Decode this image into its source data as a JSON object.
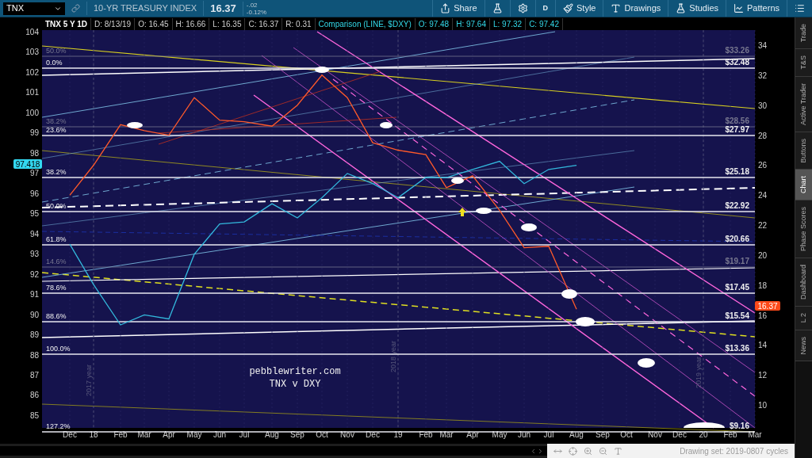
{
  "toolbar": {
    "symbol": "TNX",
    "description": "10-YR TREASURY INDEX",
    "last": "16.37",
    "change": "-.02",
    "change_pct": "-0.12%",
    "buttons": [
      {
        "kind": "share",
        "label": "Share"
      },
      {
        "kind": "flask"
      },
      {
        "kind": "gear"
      },
      {
        "kind": "text",
        "label": "D"
      },
      {
        "kind": "style",
        "label": "Style"
      },
      {
        "kind": "drawings",
        "label": "Drawings"
      },
      {
        "kind": "studies",
        "label": "Studies"
      },
      {
        "kind": "patterns",
        "label": "Patterns"
      },
      {
        "kind": "list"
      }
    ]
  },
  "info_bar": {
    "main": [
      "TNX 5 Y 1D",
      "D: 8/13/19",
      "O: 16.45",
      "H: 16.66",
      "L: 16.35",
      "C: 16.37",
      "R: 0.31"
    ],
    "comparison": "Comparison (LINE, $DXY)",
    "comparison_values": [
      "O: 97.48",
      "H: 97.64",
      "L: 97.32",
      "C: 97.42"
    ]
  },
  "chart": {
    "chart_data": {
      "type": "line",
      "categories": [
        "Dec",
        "18",
        "Feb",
        "Mar",
        "Apr",
        "May",
        "Jun",
        "Jul",
        "Aug",
        "Sep",
        "Oct",
        "Nov",
        "Dec",
        "19",
        "Feb",
        "Mar",
        "Apr",
        "May",
        "Jun",
        "Jul",
        "Aug",
        "Sep",
        "Oct",
        "Nov",
        "Dec",
        "20",
        "Feb",
        "Mar"
      ],
      "grid": true,
      "ylim": [
        84.4,
        104.1
      ],
      "y2lim": [
        8.5,
        35
      ],
      "yticks": [
        104,
        103,
        102,
        101,
        100,
        99,
        98,
        97,
        96,
        95,
        94,
        93,
        92,
        91,
        90,
        89,
        88,
        87,
        86,
        85
      ],
      "y2ticks": [
        34,
        32,
        30,
        28,
        26,
        24,
        22,
        20,
        18,
        16,
        14,
        12,
        10
      ],
      "series": [
        {
          "axis": "y2",
          "color": "#ff5a2a",
          "values": [
            24.0,
            26.0,
            28.7,
            28.3,
            28.0,
            30.5,
            29.0,
            28.9,
            28.6,
            30.0,
            32.0,
            30.5,
            27.5,
            27.0,
            26.7,
            24.5,
            25.3,
            23.0,
            20.5,
            20.6,
            16.4,
            null,
            null,
            null,
            null,
            null,
            null,
            null
          ]
        },
        {
          "color": "#33b8dc",
          "values": [
            93.5,
            91.5,
            89.5,
            90.0,
            89.8,
            93.0,
            94.5,
            94.6,
            95.5,
            94.8,
            95.8,
            97.0,
            96.5,
            95.8,
            96.8,
            96.8,
            97.2,
            97.6,
            96.5,
            97.2,
            97.4,
            null,
            null,
            null,
            null,
            null,
            null,
            null
          ]
        }
      ]
    },
    "levels": [
      {
        "fib": "50.0%",
        "price": "$33.26",
        "dim": true
      },
      {
        "fib": "0.0%",
        "price": "$32.48",
        "dim": false
      },
      {
        "fib": "38.2%",
        "price": "$28.56",
        "dim": true
      },
      {
        "fib": "23.6%",
        "price": "$27.97",
        "dim": false
      },
      {
        "fib": "38.2%",
        "price": "$25.18",
        "dim": false
      },
      {
        "fib": "50.0%",
        "price": "$22.92",
        "dim": false
      },
      {
        "fib": "61.8%",
        "price": "$20.66",
        "dim": false
      },
      {
        "fib": "14.6%",
        "price": "$19.17",
        "dim": true
      },
      {
        "fib": "78.6%",
        "price": "$17.45",
        "dim": false
      },
      {
        "fib": "88.6%",
        "price": "$15.54",
        "dim": false
      },
      {
        "fib": "100.0%",
        "price": "$13.36",
        "dim": false
      },
      {
        "fib": "127.2%",
        "price": "$9.16",
        "dim": false
      }
    ],
    "year_markers": [
      "2017 year",
      "2018 year",
      "2019 year"
    ],
    "note": [
      "pebblewriter.com",
      "TNX v DXY"
    ],
    "left_badge": "97.418",
    "right_badge": "16.37"
  },
  "sidebar": [
    {
      "label": "Trade",
      "selected": false
    },
    {
      "label": "T&S",
      "selected": false
    },
    {
      "label": "Active Trader",
      "selected": false
    },
    {
      "label": "Buttons",
      "selected": false
    },
    {
      "label": "Chart",
      "selected": true
    },
    {
      "label": "Phase Scores",
      "selected": false
    },
    {
      "label": "Dashboard",
      "selected": false
    },
    {
      "label": "L 2",
      "selected": false
    },
    {
      "label": "News",
      "selected": false
    }
  ],
  "status_bar": {
    "drawing_set": "Drawing set: 2019-0807 cycles"
  }
}
